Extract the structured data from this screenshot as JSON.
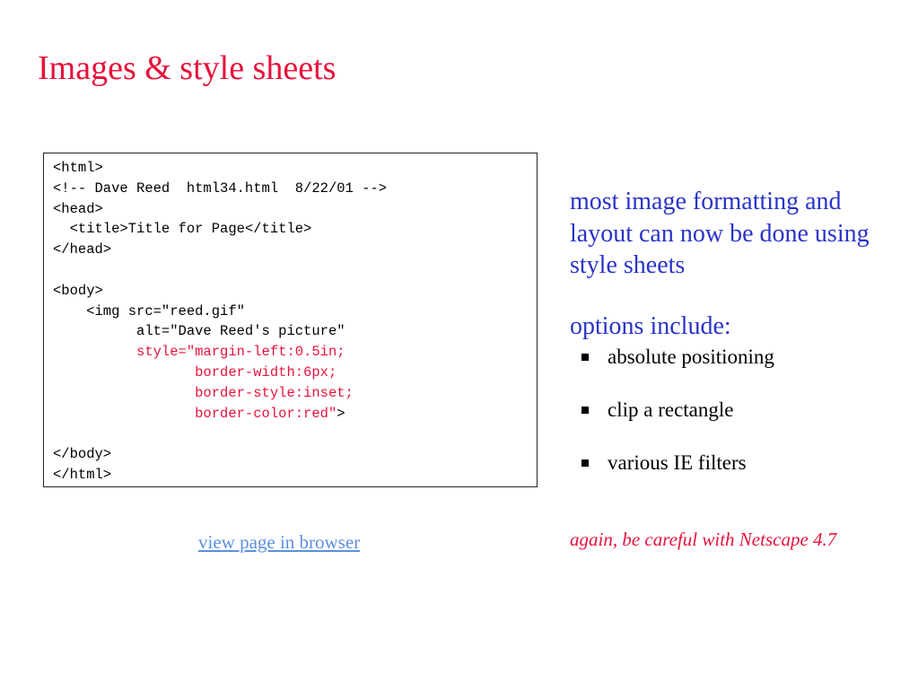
{
  "slide": {
    "title": "Images & style sheets"
  },
  "code": {
    "lines": [
      [
        {
          "text": "<html>",
          "color": "black"
        }
      ],
      [
        {
          "text": "<!-- Dave Reed  html34.html  8/22/01 -->",
          "color": "black"
        }
      ],
      [
        {
          "text": "<head>",
          "color": "black"
        }
      ],
      [
        {
          "text": "  <title>Title for Page</title>",
          "color": "black"
        }
      ],
      [
        {
          "text": "</head>",
          "color": "black"
        }
      ],
      [
        {
          "text": "",
          "color": "black"
        }
      ],
      [
        {
          "text": "<body>",
          "color": "black"
        }
      ],
      [
        {
          "text": "    <img src=\"reed.gif\"",
          "color": "black"
        }
      ],
      [
        {
          "text": "          alt=\"Dave Reed's picture\"",
          "color": "black"
        }
      ],
      [
        {
          "text": "          style=\"margin-left:0.5in;",
          "color": "red"
        }
      ],
      [
        {
          "text": "                 border-width:6px;",
          "color": "red"
        }
      ],
      [
        {
          "text": "                 border-style:inset;",
          "color": "red"
        }
      ],
      [
        {
          "text": "                 border-color:red\"",
          "color": "red"
        },
        {
          "text": ">",
          "color": "black"
        }
      ],
      [
        {
          "text": "",
          "color": "black"
        }
      ],
      [
        {
          "text": "</body>",
          "color": "black"
        }
      ],
      [
        {
          "text": "</html>",
          "color": "black"
        }
      ]
    ]
  },
  "link": {
    "label": "view page in browser"
  },
  "right": {
    "intro": "most image formatting and layout can now be done using style sheets",
    "options_heading": "options include:",
    "bullets": [
      "absolute positioning",
      "clip a rectangle",
      "various IE filters"
    ],
    "note": "again, be careful with Netscape 4.7"
  },
  "colors": {
    "title": "#e6133c",
    "blue_text": "#2a33c8",
    "link": "#5b8fe0",
    "red_code": "#e6133c"
  }
}
